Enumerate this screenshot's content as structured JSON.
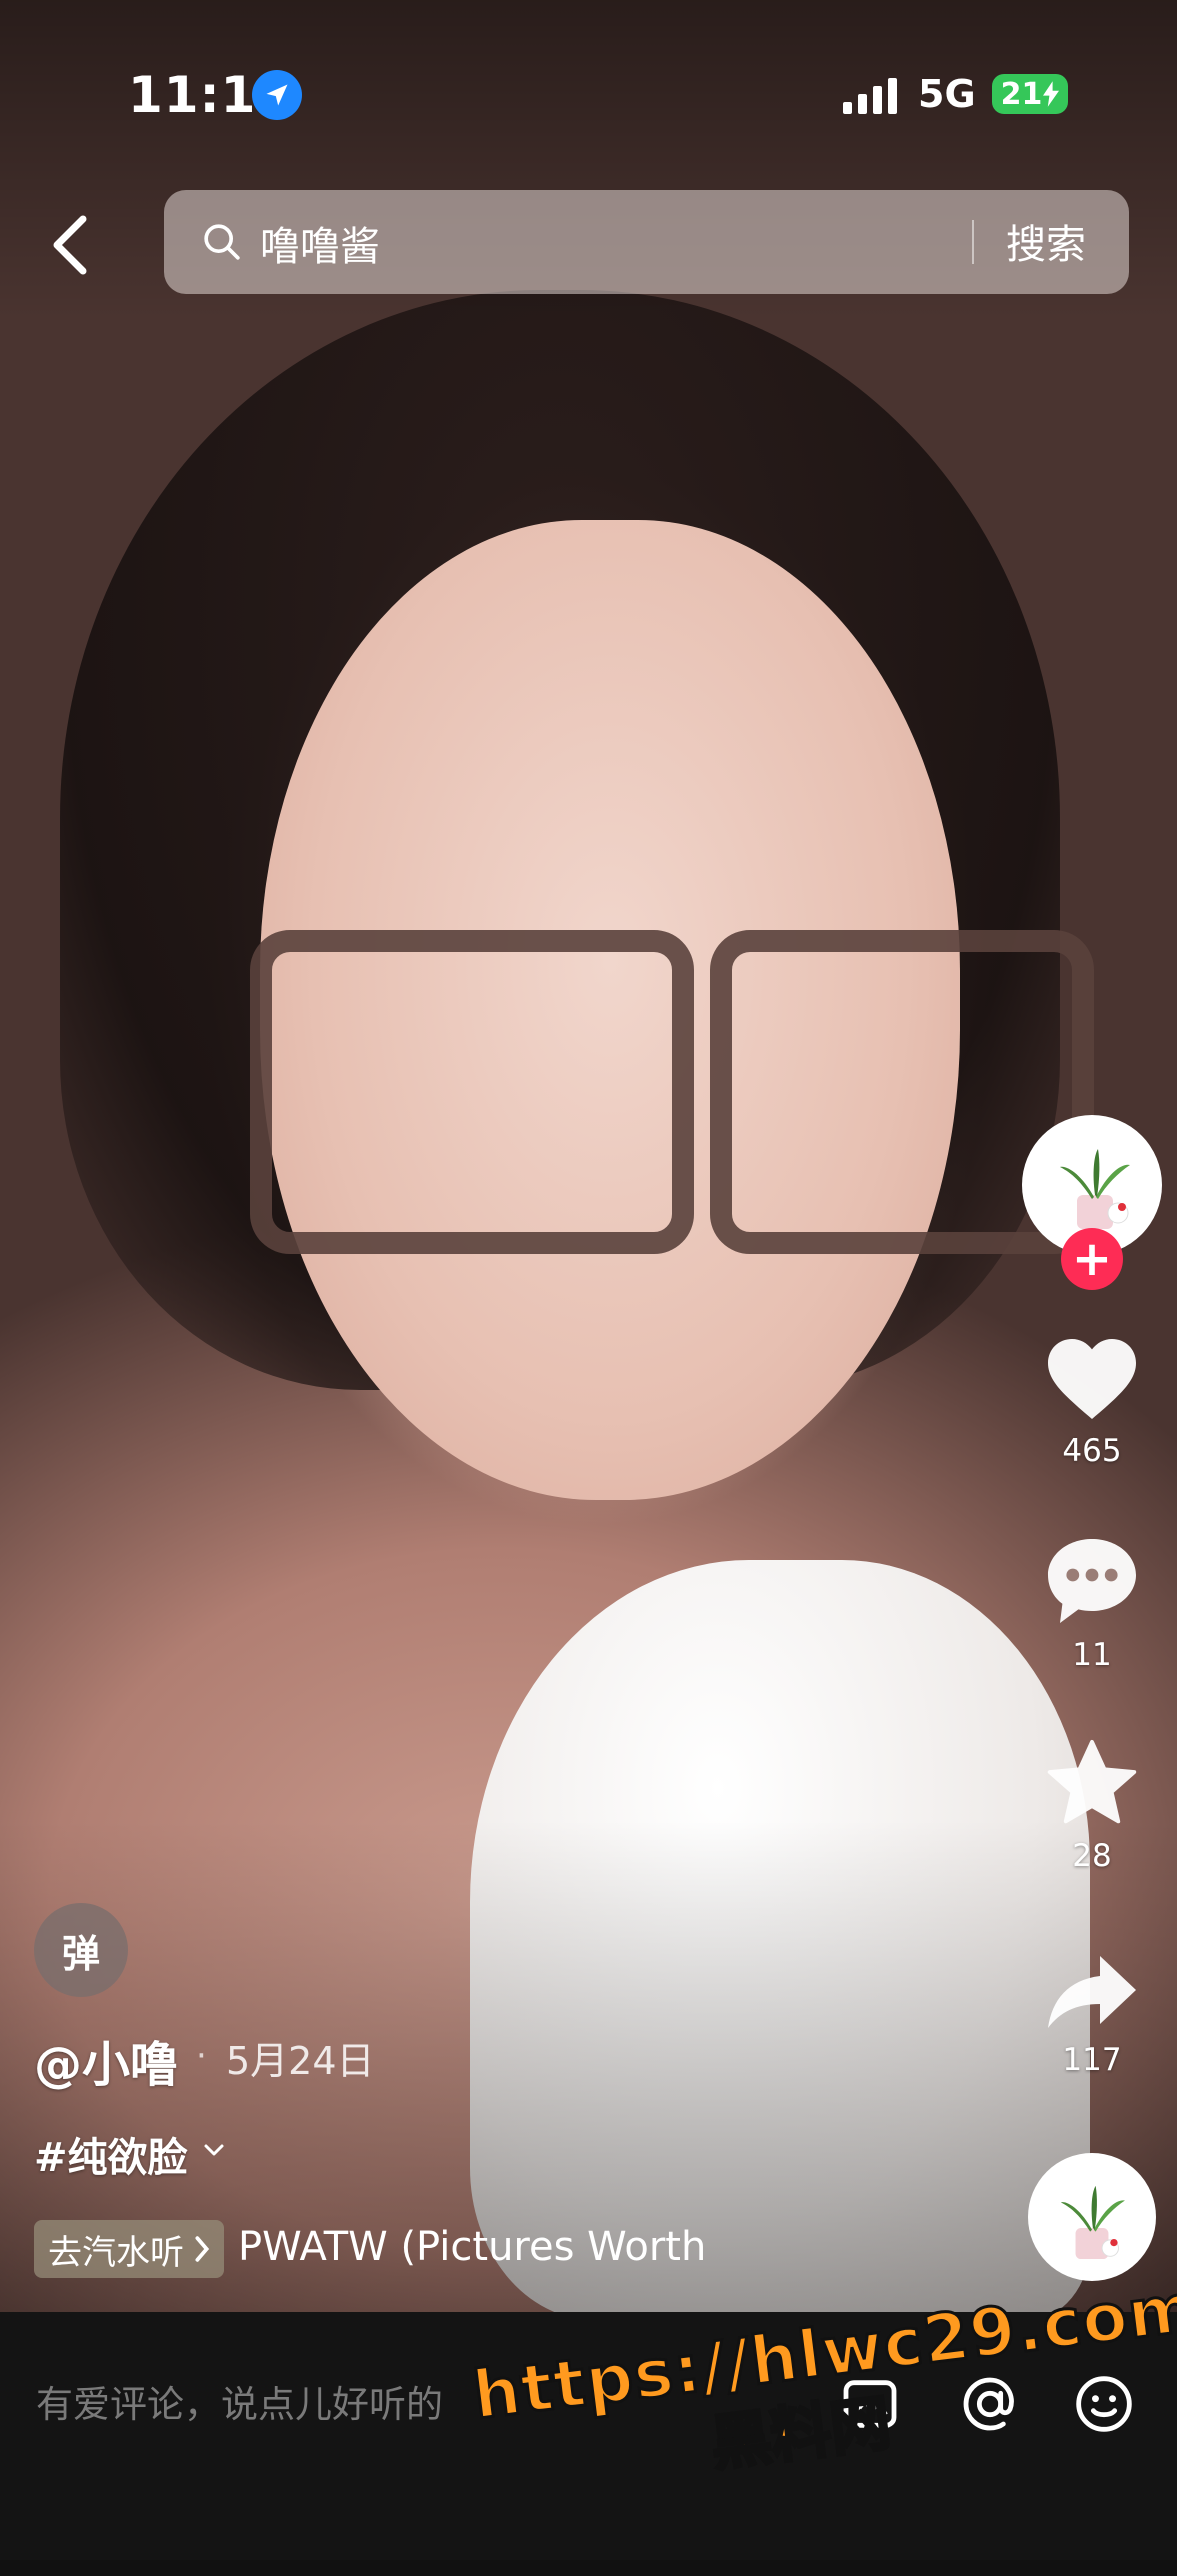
{
  "status_bar": {
    "time": "11:19",
    "network": "5G",
    "battery": "21"
  },
  "search": {
    "query": "噜噜酱",
    "button_label": "搜索"
  },
  "rail": {
    "likes": "465",
    "comments": "11",
    "favorites": "28",
    "shares": "117",
    "follow_symbol": "+"
  },
  "post": {
    "danmu_label": "弹",
    "author": "@小噜",
    "date": "5月24日",
    "hashtag": "#纯欲脸",
    "music_button": "去汽水听",
    "music_title": "PWATW (Pictures Worth"
  },
  "bottom_bar": {
    "comment_placeholder": "有爱评论，说点儿好听的"
  },
  "watermark": {
    "url": "https://hlwc29.com",
    "name": "黑料网"
  },
  "colors": {
    "follow": "#fe2c55",
    "location": "#1e88ff",
    "battery": "#35c759",
    "watermark": "#ff9a1f"
  }
}
